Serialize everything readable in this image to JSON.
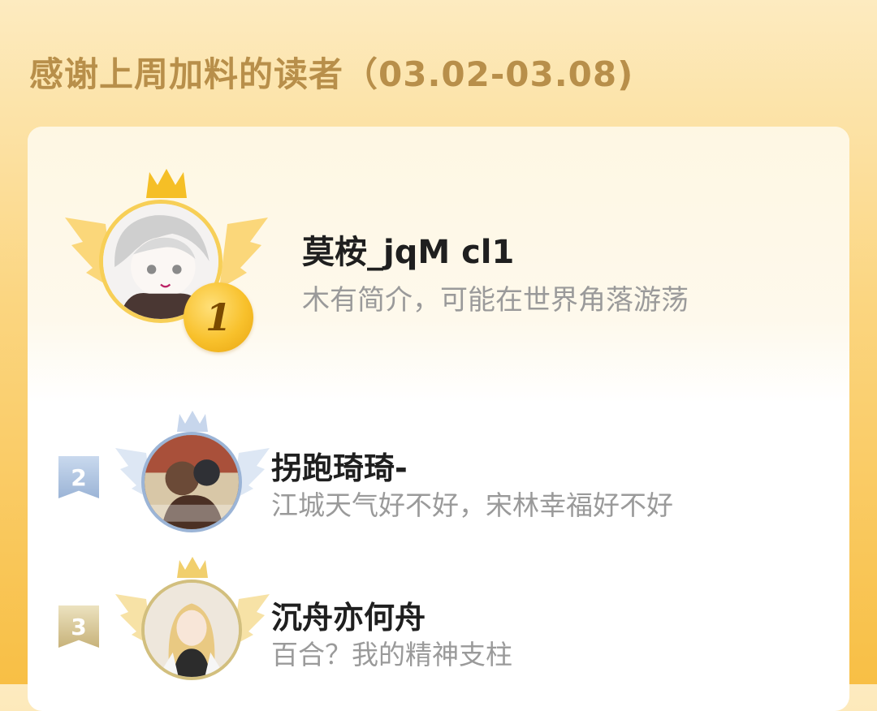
{
  "page": {
    "title": "感谢上周加料的读者（03.02-03.08)"
  },
  "colors": {
    "title": "#b88f4a",
    "background_top": "#fdebc0",
    "background_bottom": "#f8bf45",
    "gold_medal": "#f8c12c",
    "silver_badge": "#9bb4d6",
    "bronze_badge": "#c7b27a",
    "name_text": "#1f1f1f",
    "bio_text": "#9a9a9a"
  },
  "leaderboard": [
    {
      "rank": "1",
      "name": "莫桉_jqM cl1",
      "bio": "木有简介，可能在世界角落游荡",
      "avatar_icon": "anime-avatar-white-hair",
      "decoration": "gold-crown-wings"
    },
    {
      "rank": "2",
      "name": "拐跑琦琦-",
      "bio": "江城天气好不好，宋林幸福好不好",
      "avatar_icon": "anime-avatar-comic-cover",
      "decoration": "silver-crown-wings"
    },
    {
      "rank": "3",
      "name": "沉舟亦何舟",
      "bio": "百合？我的精神支柱",
      "avatar_icon": "anime-avatar-blonde",
      "decoration": "bronze-crown-wings"
    }
  ]
}
